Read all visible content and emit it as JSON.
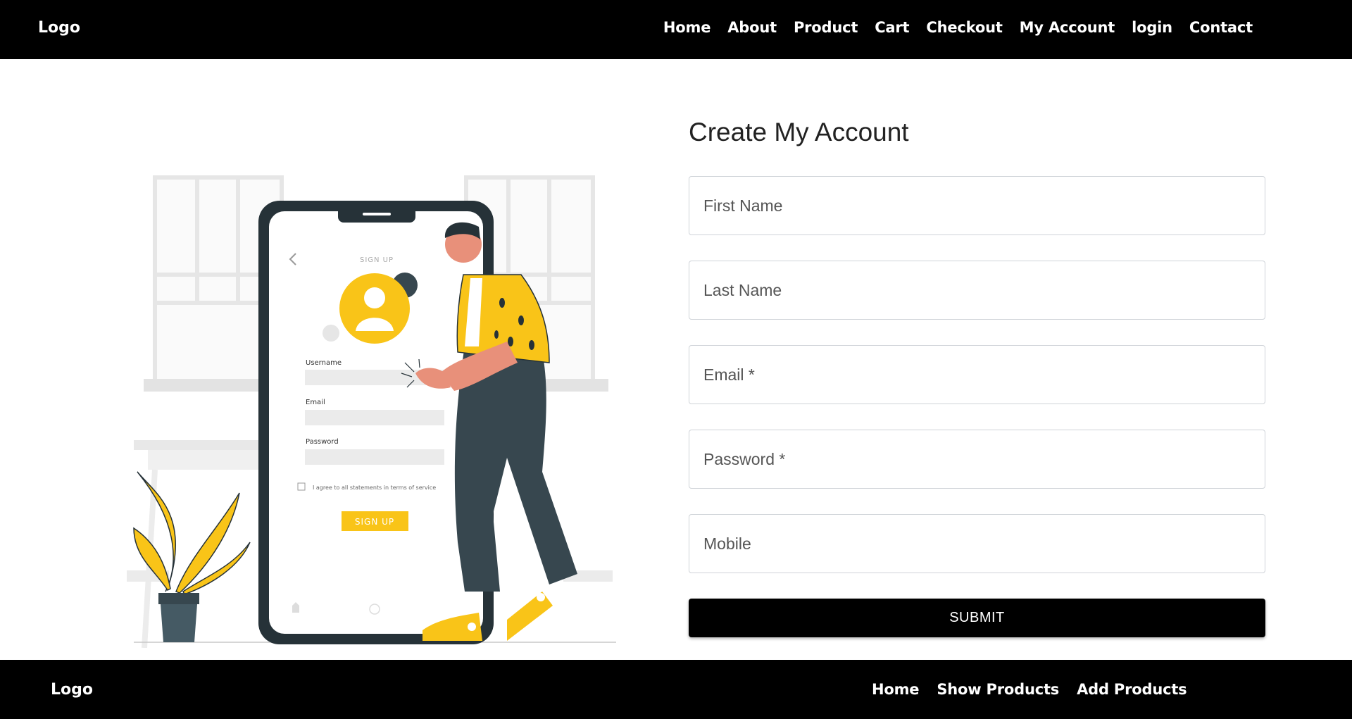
{
  "header": {
    "logo": "Logo",
    "nav": [
      "Home",
      "About",
      "Product",
      "Cart",
      "Checkout",
      "My Account",
      "login",
      "Contact"
    ]
  },
  "illustration": {
    "phone_title": "SIGN UP",
    "username_label": "Username",
    "email_label": "Email",
    "password_label": "Password",
    "agree_text": "I agree to all statements in terms of service",
    "signup_button": "SIGN UP",
    "accent_color": "#F9C418",
    "dark_color": "#263238"
  },
  "form": {
    "title": "Create My Account",
    "fields": [
      {
        "placeholder": "First Name",
        "value": ""
      },
      {
        "placeholder": "Last Name",
        "value": ""
      },
      {
        "placeholder": "Email *",
        "value": ""
      },
      {
        "placeholder": "Password *",
        "value": ""
      },
      {
        "placeholder": "Mobile",
        "value": ""
      }
    ],
    "submit_label": "SUBMIT"
  },
  "footer": {
    "logo": "Logo",
    "nav": [
      "Home",
      "Show Products",
      "Add Products"
    ]
  },
  "colors": {
    "header_bg": "#000000",
    "footer_bg": "#000000",
    "button_bg": "#000000",
    "border": "#cfd3d8"
  }
}
